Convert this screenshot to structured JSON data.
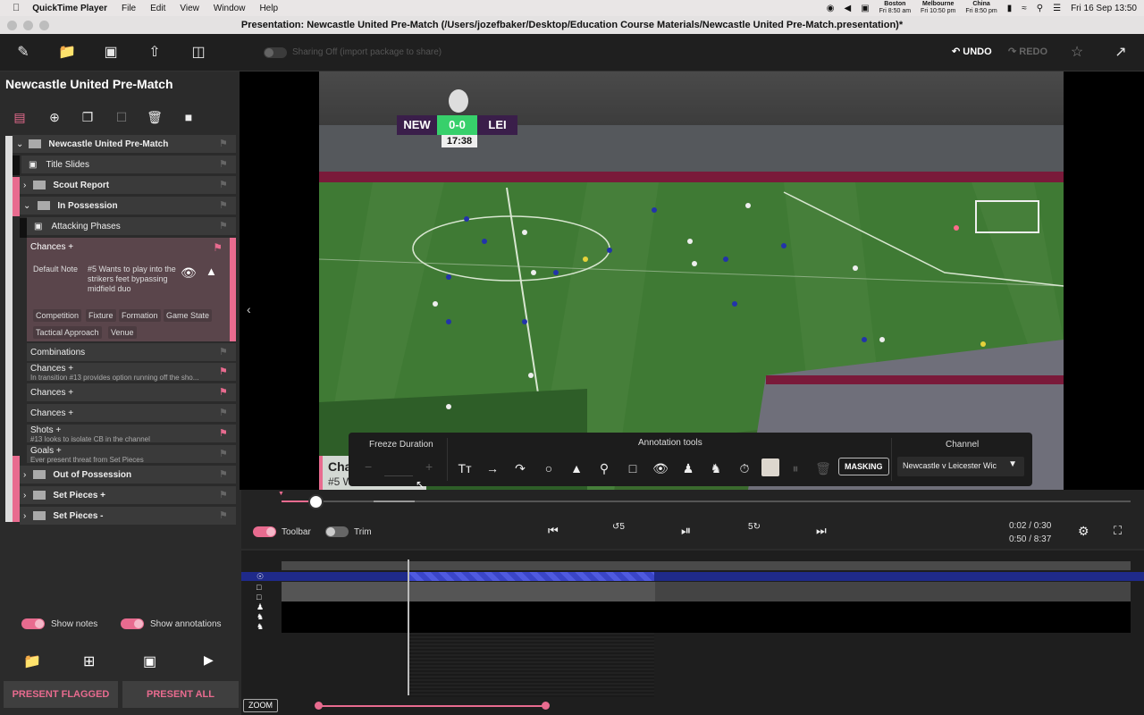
{
  "menubar": {
    "app": "QuickTime Player",
    "items": [
      "File",
      "Edit",
      "View",
      "Window",
      "Help"
    ],
    "clocks": [
      {
        "city": "Boston",
        "time": "Fri 8:50 am"
      },
      {
        "city": "Melbourne",
        "time": "Fri 10:50 pm"
      },
      {
        "city": "China",
        "time": "Fri 8:50 pm"
      }
    ],
    "datetime": "Fri 16 Sep  13:50"
  },
  "window": {
    "title": "Presentation: Newcastle United Pre-Match (/Users/jozefbaker/Desktop/Education Course Materials/Newcastle United Pre-Match.presentation)*"
  },
  "toolbar": {
    "sharing": "Sharing Off (import package to share)",
    "undo": "UNDO",
    "redo": "REDO"
  },
  "sidebar": {
    "title": "Newcastle United Pre-Match",
    "tree": [
      {
        "label": "Newcastle United Pre-Match",
        "flagged": false
      },
      {
        "label": "Title Slides",
        "flagged": false
      },
      {
        "label": "Scout Report",
        "flagged": false
      },
      {
        "label": "In Possession",
        "flagged": false
      },
      {
        "label": "Attacking Phases",
        "flagged": false
      },
      {
        "label": "Chances +",
        "flagged": true
      },
      {
        "label": "Combinations",
        "flagged": false
      },
      {
        "label": "Chances +",
        "sub": "In transition #13 provides option running off the sho...",
        "flagged": true
      },
      {
        "label": "Chances +",
        "flagged": true
      },
      {
        "label": "Chances +",
        "flagged": false
      },
      {
        "label": "Shots +",
        "sub": "#13 looks to isolate CB in the channel",
        "flagged": true
      },
      {
        "label": "Goals +",
        "sub": "Ever present threat from Set Pieces",
        "flagged": false
      },
      {
        "label": "Out of Possession",
        "flagged": false
      },
      {
        "label": "Set Pieces +",
        "flagged": false
      },
      {
        "label": "Set Pieces -",
        "flagged": false
      }
    ],
    "note_label": "Default Note",
    "note_text": "#5 Wants to play into the strikers feet bypassing midfield duo",
    "tags": [
      "Competition",
      "Fixture",
      "Formation",
      "Game State",
      "Tactical Approach",
      "Venue"
    ],
    "show_notes": "Show notes",
    "show_annotations": "Show annotations",
    "present_flagged": "PRESENT FLAGGED",
    "present_all": "PRESENT ALL"
  },
  "video": {
    "home": "NEW",
    "score": "0-0",
    "away": "LEI",
    "clock": "17:38",
    "caption_title": "Cha",
    "caption_sub": "#5 W"
  },
  "annotation": {
    "freeze_label": "Freeze Duration",
    "tools_label": "Annotation tools",
    "channel_label": "Channel",
    "masking": "MASKING",
    "channel_value": "Newcastle v Leicester Wic"
  },
  "controls": {
    "toolbar_label": "Toolbar",
    "trim_label": "Trim",
    "time_clip": "0:02 / 0:30",
    "time_total": "0:50 / 8:37",
    "skip_back": "5",
    "skip_fwd": "5",
    "progress": 0.04
  },
  "timeline": {
    "zoom": "ZOOM"
  },
  "colors": {
    "accent": "#e86b8f",
    "selection": "#3a45c8"
  }
}
